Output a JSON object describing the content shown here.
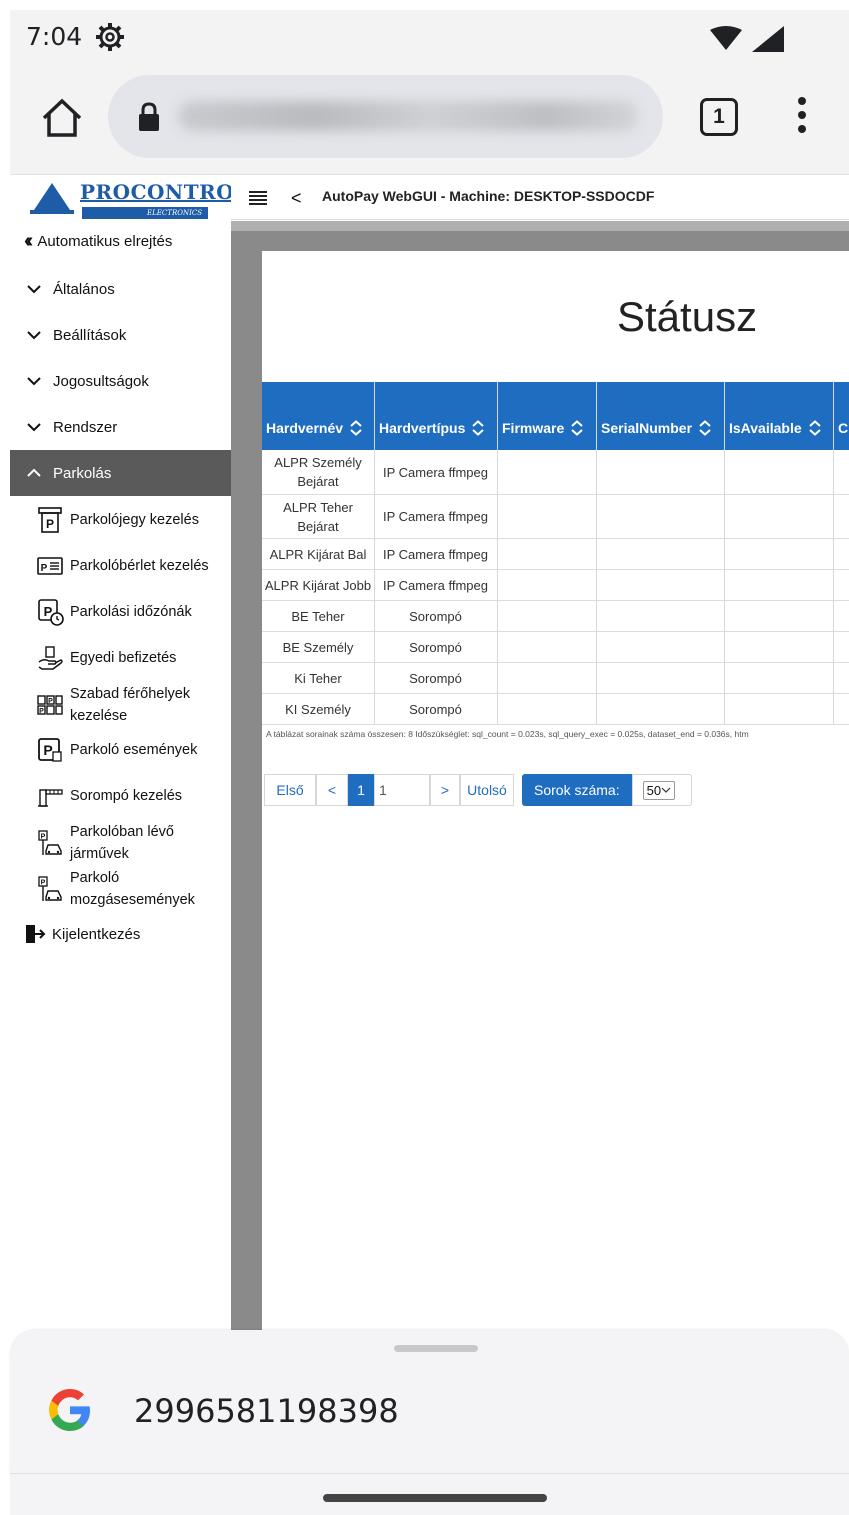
{
  "status_bar": {
    "time": "7:04"
  },
  "browser": {
    "tab_count": "1"
  },
  "sidebar": {
    "logo": {
      "name": "PROCONTROL",
      "sub": "ELECTRONICS"
    },
    "collapse_label": "Automatikus elrejtés",
    "groups": [
      {
        "label": "Általános"
      },
      {
        "label": "Beállítások"
      },
      {
        "label": "Jogosultságok"
      },
      {
        "label": "Rendszer"
      },
      {
        "label": "Parkolás"
      }
    ],
    "parking_items": [
      {
        "label": "Parkolójegy kezelés"
      },
      {
        "label": "Parkolóbérlet kezelés"
      },
      {
        "label": "Parkolási időzónák"
      },
      {
        "label": "Egyedi befizetés"
      },
      {
        "label": "Szabad férőhelyek kezelése"
      },
      {
        "label": "Parkoló események"
      },
      {
        "label": "Sorompó kezelés"
      },
      {
        "label": "Parkolóban lévő járművek"
      },
      {
        "label": "Parkoló mozgásesemények"
      }
    ],
    "logout_label": "Kijelentkezés"
  },
  "header": {
    "back_symbol": "<",
    "title": "AutoPay WebGUI - Machine: DESKTOP-SSDOCDF"
  },
  "page": {
    "title": "Státusz",
    "table": {
      "columns": [
        "Hardvernév",
        "Hardvertípus",
        "Firmware",
        "SerialNumber",
        "IsAvailable",
        "C"
      ],
      "rows": [
        [
          "ALPR Személy Bejárat",
          "IP Camera ffmpeg",
          "",
          "",
          "",
          ""
        ],
        [
          "ALPR Teher Bejárat",
          "IP Camera ffmpeg",
          "",
          "",
          "",
          ""
        ],
        [
          "ALPR Kijárat Bal",
          "IP Camera ffmpeg",
          "",
          "",
          "",
          ""
        ],
        [
          "ALPR Kijárat Jobb",
          "IP Camera ffmpeg",
          "",
          "",
          "",
          ""
        ],
        [
          "BE Teher",
          "Sorompó",
          "",
          "",
          "",
          ""
        ],
        [
          "BE Személy",
          "Sorompó",
          "",
          "",
          "",
          ""
        ],
        [
          "Ki Teher",
          "Sorompó",
          "",
          "",
          "",
          ""
        ],
        [
          "KI Személy",
          "Sorompó",
          "",
          "",
          "",
          ""
        ]
      ]
    },
    "footnote": "A táblázat sorainak száma összesen: 8   Időszükséglet: sql_count = 0.023s, sql_query_exec = 0.025s, dataset_end = 0.036s, htm",
    "pager": {
      "first": "Első",
      "prev": "<",
      "current": "1",
      "page_input": "1",
      "next": ">",
      "last": "Utolsó",
      "rows_label": "Sorok száma:",
      "rows_value": "50"
    }
  },
  "bottom_sheet": {
    "code": "2996581198398"
  },
  "colors": {
    "accent": "#1f6dc0",
    "brand": "#1f5ca8",
    "sidebar_active": "#5a5a5a"
  }
}
